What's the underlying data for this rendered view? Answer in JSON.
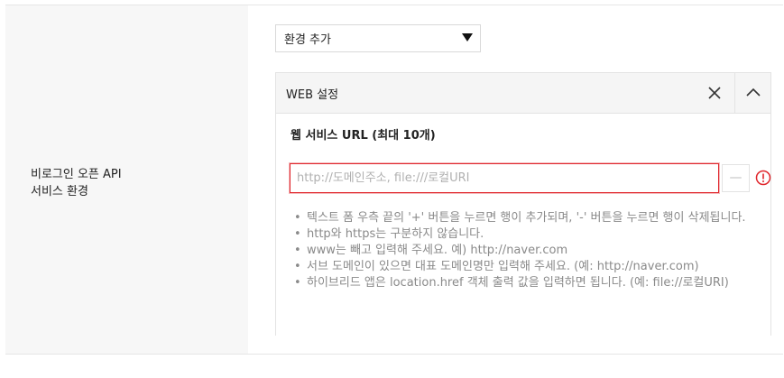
{
  "section": {
    "label_line1": "비로그인 오픈 API",
    "label_line2": "서비스 환경"
  },
  "env_select": {
    "value": "환경 추가"
  },
  "panel": {
    "title": "WEB 설정",
    "field_title": "웹 서비스 URL (최대 10개)",
    "url_input": {
      "value": "",
      "placeholder": "http://도메인주소, file:///로컬URI"
    },
    "minus_label": "—",
    "help_items": [
      "텍스트 폼 우측 끝의 '+' 버튼을 누르면 행이 추가되며, '-' 버튼을 누르면 행이 삭제됩니다.",
      "http와 https는 구분하지 않습니다.",
      "www는 빼고 입력해 주세요. 예) http://naver.com",
      "서브 도메인이 있으면 대표 도메인명만 입력해 주세요. (예: http://naver.com)",
      "하이브리드 앱은 location.href 객체 출력 값을 입력하면 됩니다. (예: file://로컬URI)"
    ]
  },
  "icons": {
    "select_arrow": "caret-down-icon",
    "close": "close-icon",
    "collapse": "chevron-up-icon",
    "error": "error-icon"
  },
  "colors": {
    "error_red": "#e0262c",
    "label_bg": "#f7f7f7",
    "panel_head_bg": "#f5f5f5",
    "help_text": "#8a8a8a"
  }
}
